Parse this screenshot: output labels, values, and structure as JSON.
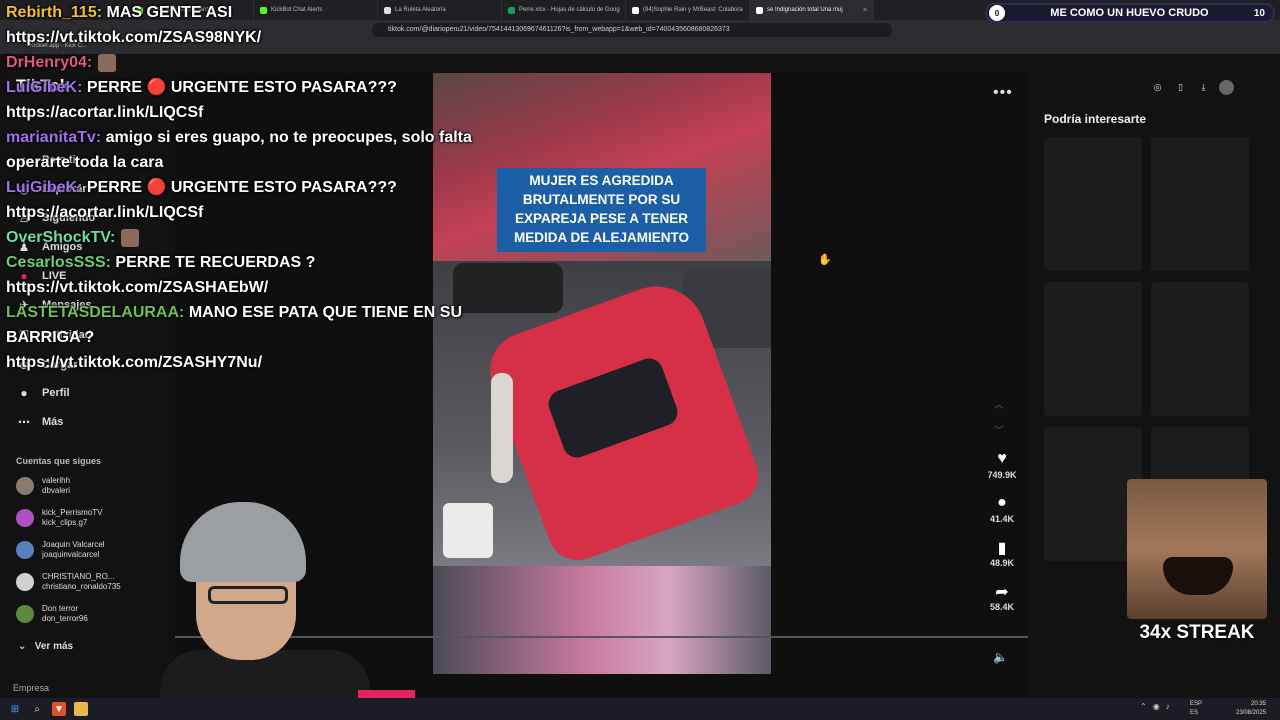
{
  "browser": {
    "tabs": [
      {
        "label": "",
        "color": "#444"
      },
      {
        "label": "ream - Kick Dashboard",
        "color": "#53fc18"
      },
      {
        "label": "KickBot Chat Alerts",
        "color": "#53fc18"
      },
      {
        "label": "La Ruleta Aleatoria",
        "color": "#dddddd"
      },
      {
        "label": "Perre.xlsx - Hojas de cálculo de Goog",
        "color": "#0f9d58"
      },
      {
        "label": "(84)Sophie Rain y MrBeast: Colabora",
        "color": "#ffffff"
      },
      {
        "label": "se Indignación total Una muj",
        "color": "#ffffff"
      }
    ],
    "tab_close": "×",
    "url": "tiktok.com/@diarioperu21/video/7541441306967461126?is_from_webapp=1&web_id=7400435608680826373",
    "bookmark": "Kicklet.app - Kick C..."
  },
  "banner": {
    "left_num": "0",
    "text": "ME COMO UN HUEVO CRUDO",
    "right_num": "10"
  },
  "sidebar": {
    "logo": "TikTok",
    "nav": [
      {
        "label": "Para ti",
        "icon": "home-icon"
      },
      {
        "label": "Explorar",
        "icon": "compass-icon"
      },
      {
        "label": "Siguiendo",
        "icon": "user-follow-icon"
      },
      {
        "label": "Amigos",
        "icon": "friends-icon"
      },
      {
        "label": "LIVE",
        "icon": "live-icon"
      },
      {
        "label": "Mensajes",
        "icon": "send-icon"
      },
      {
        "label": "Actividad",
        "icon": "activity-icon"
      },
      {
        "label": "Cargar",
        "icon": "upload-icon"
      },
      {
        "label": "Perfil",
        "icon": "profile-icon"
      },
      {
        "label": "Más",
        "icon": "more-icon"
      }
    ],
    "following_title": "Cuentas que sigues",
    "following": [
      {
        "name": "valerihh",
        "handle": "dbvaleri",
        "color": "#8a7b70"
      },
      {
        "name": "kick_PerrismoTV",
        "handle": "kick_clips.g7",
        "color": "#b050c0"
      },
      {
        "name": "Joaquin Valcarcel",
        "handle": "joaquinvalcarcel",
        "color": "#5a7fbf"
      },
      {
        "name": "CHRISTIANO_RO...",
        "handle": "christiano_ronaldo735",
        "color": "#d0d0d0"
      },
      {
        "name": "Don terror",
        "handle": "don_terror96",
        "color": "#5a8a3a"
      }
    ],
    "see_more": "Ver más",
    "company": "Empresa"
  },
  "video": {
    "caption": "MUJER ES AGREDIDA BRUTALMENTE POR SU EXPAREJA PESE A TENER MEDIDA DE ALEJAMIENTO",
    "actions": [
      {
        "icon": "heart-icon",
        "count": "749.9K"
      },
      {
        "icon": "comment-icon",
        "count": "41.4K"
      },
      {
        "icon": "bookmark-icon",
        "count": "48.9K"
      },
      {
        "icon": "share-icon",
        "count": "58.4K"
      }
    ]
  },
  "suggest": {
    "title": "Podría interesarte"
  },
  "chat": [
    {
      "user": "Rebirth_115:",
      "color": "#f0c030",
      "msg": "MAS GENTE ASI",
      "link": "https://vt.tiktok.com/ZSAS98NYK/"
    },
    {
      "user": "DrHenry04:",
      "color": "#e05a7a",
      "msg": "",
      "link": ""
    },
    {
      "user": "LuiGibeK:",
      "color": "#a070f0",
      "msg": "PERRE 🔴 URGENTE ESTO PASARA???",
      "link": "https://acortar.link/LIQCSf"
    },
    {
      "user": "marianitaTv:",
      "color": "#a070f0",
      "msg": "amigo si eres guapo, no te preocupes, solo falta operarte toda la cara",
      "link": ""
    },
    {
      "user": "LuiGibeK:",
      "color": "#a070f0",
      "msg": "PERRE 🔴 URGENTE ESTO PASARA???",
      "link": "https://acortar.link/LIQCSf"
    },
    {
      "user": "OverShockTV:",
      "color": "#6ae0a0",
      "msg": "",
      "link": ""
    },
    {
      "user": "CesarlosSSS:",
      "color": "#6ad070",
      "msg": "PERRE TE RECUERDAS ?",
      "link": "https://vt.tiktok.com/ZSASHAEbW/"
    },
    {
      "user": "LASTETASDELAURAA:",
      "color": "#70c050",
      "msg": "MANO ESE PATA QUE TIENE EN SU BARRIGA ?",
      "link": "https://vt.tiktok.com/ZSASHY7Nu/"
    }
  ],
  "streak": {
    "text": "34x STREAK"
  },
  "taskbar": {
    "lang_top": "ESP",
    "lang_bottom": "ES",
    "time": "20:35",
    "date": "23/08/2025"
  }
}
